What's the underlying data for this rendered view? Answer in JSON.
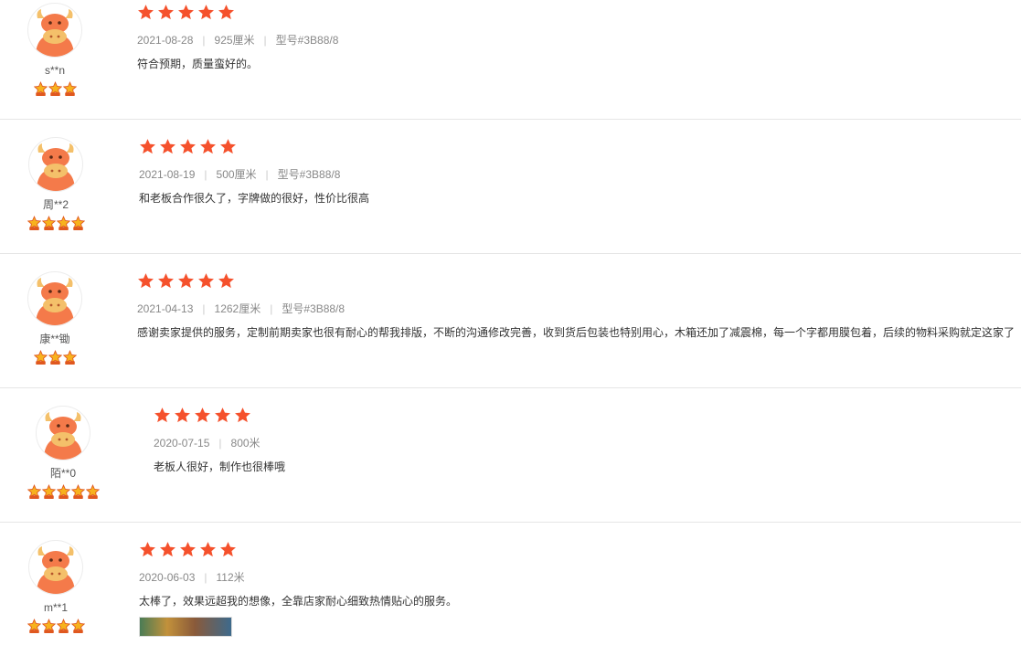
{
  "colors": {
    "star": "#f5512c",
    "level_star": "#f7b21e",
    "avatar_face": "#f47a4a",
    "horn": "#f4c06a"
  },
  "reviews": [
    {
      "user": "s**n",
      "level_count": 3,
      "rating": 5,
      "date": "2021-08-28",
      "size": "925厘米",
      "model": "型号#3B88/8",
      "text": "符合预期，质量蛮好的。"
    },
    {
      "user": "周**2",
      "level_count": 4,
      "rating": 5,
      "date": "2021-08-19",
      "size": "500厘米",
      "model": "型号#3B88/8",
      "text": "和老板合作很久了，字牌做的很好，性价比很高"
    },
    {
      "user": "康**锄",
      "level_count": 3,
      "rating": 5,
      "date": "2021-04-13",
      "size": "1262厘米",
      "model": "型号#3B88/8",
      "text": "感谢卖家提供的服务，定制前期卖家也很有耐心的帮我排版，不断的沟通修改完善，收到货后包装也特别用心，木箱还加了减震棉，每一个字都用膜包着，后续的物料采购就定这家了"
    },
    {
      "user": "陌**0",
      "level_count": 5,
      "rating": 5,
      "date": "2020-07-15",
      "size": "800米",
      "model": "",
      "text": "老板人很好，制作也很棒哦"
    },
    {
      "user": "m**1",
      "level_count": 4,
      "rating": 5,
      "date": "2020-06-03",
      "size": "112米",
      "model": "",
      "text": "太棒了，效果远超我的想像，全靠店家耐心细致热情贴心的服务。"
    }
  ]
}
